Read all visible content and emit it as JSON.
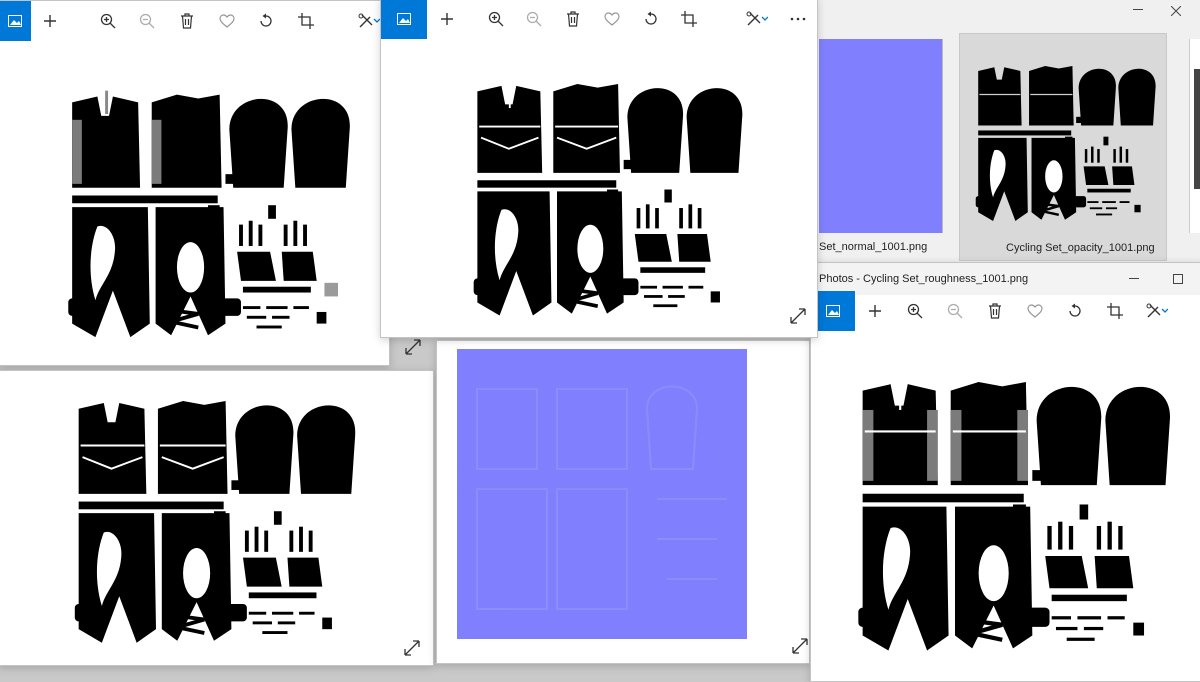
{
  "windows": {
    "top_right_gallery": {
      "thumbnails": [
        {
          "caption": "Set_normal_1001.png"
        },
        {
          "caption": "Cycling Set_opacity_1001.png"
        }
      ]
    },
    "roughness": {
      "title": "Photos - Cycling Set_roughness_1001.png"
    }
  },
  "toolbar_icons": [
    "image-icon",
    "add-icon",
    "zoom-in-icon",
    "zoom-out-icon",
    "delete-icon",
    "favorite-icon",
    "rotate-icon",
    "crop-icon",
    "edit-icon",
    "more-icon"
  ],
  "colors": {
    "accent": "#0078d7",
    "navy": "#17213f",
    "camo_dark": "#2b3346",
    "camo_light": "#6f7a89",
    "normal_blue": "#8080ff",
    "gray_piece": "#595959",
    "opacity_gray": "#e2e2e2"
  }
}
